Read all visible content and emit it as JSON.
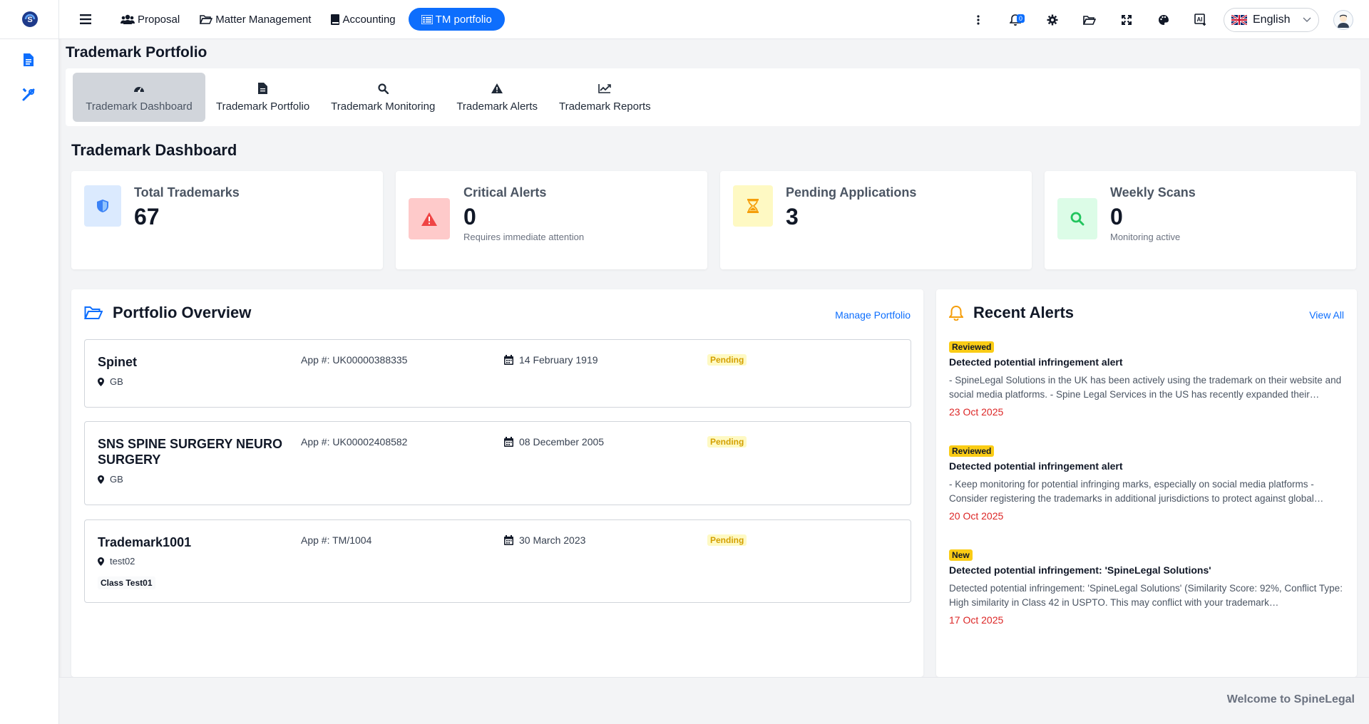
{
  "topbar": {
    "nav": [
      {
        "label": "Proposal",
        "icon": "users-icon"
      },
      {
        "label": "Matter Management",
        "icon": "folder-open-icon"
      },
      {
        "label": "Accounting",
        "icon": "book-icon"
      },
      {
        "label": "TM portfolio",
        "icon": "list-icon"
      }
    ],
    "notifications_count": "0",
    "language": "English"
  },
  "page": {
    "title": "Trademark Portfolio"
  },
  "tabs": [
    {
      "label": "Trademark Dashboard",
      "icon": "dashboard-gauge-icon"
    },
    {
      "label": "Trademark Portfolio",
      "icon": "file-icon"
    },
    {
      "label": "Trademark Monitoring",
      "icon": "search-icon"
    },
    {
      "label": "Trademark Alerts",
      "icon": "warning-icon"
    },
    {
      "label": "Trademark Reports",
      "icon": "line-chart-icon"
    }
  ],
  "dashboard": {
    "title": "Trademark Dashboard",
    "stats": [
      {
        "title": "Total Trademarks",
        "value": "67",
        "sub": "",
        "icon": "shield-icon",
        "color": "#3b82f6"
      },
      {
        "title": "Critical Alerts",
        "value": "0",
        "sub": "Requires immediate attention",
        "icon": "warning-icon",
        "color": "#ef4444"
      },
      {
        "title": "Pending Applications",
        "value": "3",
        "sub": "",
        "icon": "hourglass-icon",
        "color": "#f59e0b"
      },
      {
        "title": "Weekly Scans",
        "value": "0",
        "sub": "Monitoring active",
        "icon": "search-icon",
        "color": "#22c55e"
      }
    ]
  },
  "portfolio": {
    "title": "Portfolio Overview",
    "link": "Manage Portfolio",
    "items": [
      {
        "name": "Spinet",
        "location": "GB",
        "app": "App #: UK00000388335",
        "date": "14 February 1919",
        "status": "Pending",
        "class_tag": ""
      },
      {
        "name": "SNS SPINE SURGERY NEURO SURGERY",
        "location": "GB",
        "app": "App #: UK00002408582",
        "date": "08 December 2005",
        "status": "Pending",
        "class_tag": ""
      },
      {
        "name": "Trademark1001",
        "location": "test02",
        "app": "App #: TM/1004",
        "date": "30 March 2023",
        "status": "Pending",
        "class_tag": "Class Test01"
      }
    ]
  },
  "alerts": {
    "title": "Recent Alerts",
    "link": "View All",
    "items": [
      {
        "badge": "Reviewed",
        "title": "Detected potential infringement alert",
        "desc": "- SpineLegal Solutions in the UK has been actively using the trademark on their website and social media platforms. - Spine Legal Services in the US has recently expanded their…",
        "date": "23 Oct 2025"
      },
      {
        "badge": "Reviewed",
        "title": "Detected potential infringement alert",
        "desc": "- Keep monitoring for potential infringing marks, especially on social media platforms - Consider registering the trademarks in additional jurisdictions to protect against global…",
        "date": "20 Oct 2025"
      },
      {
        "badge": "New",
        "title": "Detected potential infringement: 'SpineLegal Solutions'",
        "desc": "Detected potential infringement: 'SpineLegal Solutions' (Similarity Score: 92%, Conflict Type: High similarity in Class 42 in USPTO. This may conflict with your trademark…",
        "date": "17 Oct 2025"
      }
    ]
  },
  "footer": {
    "text": "Welcome to SpineLegal"
  }
}
